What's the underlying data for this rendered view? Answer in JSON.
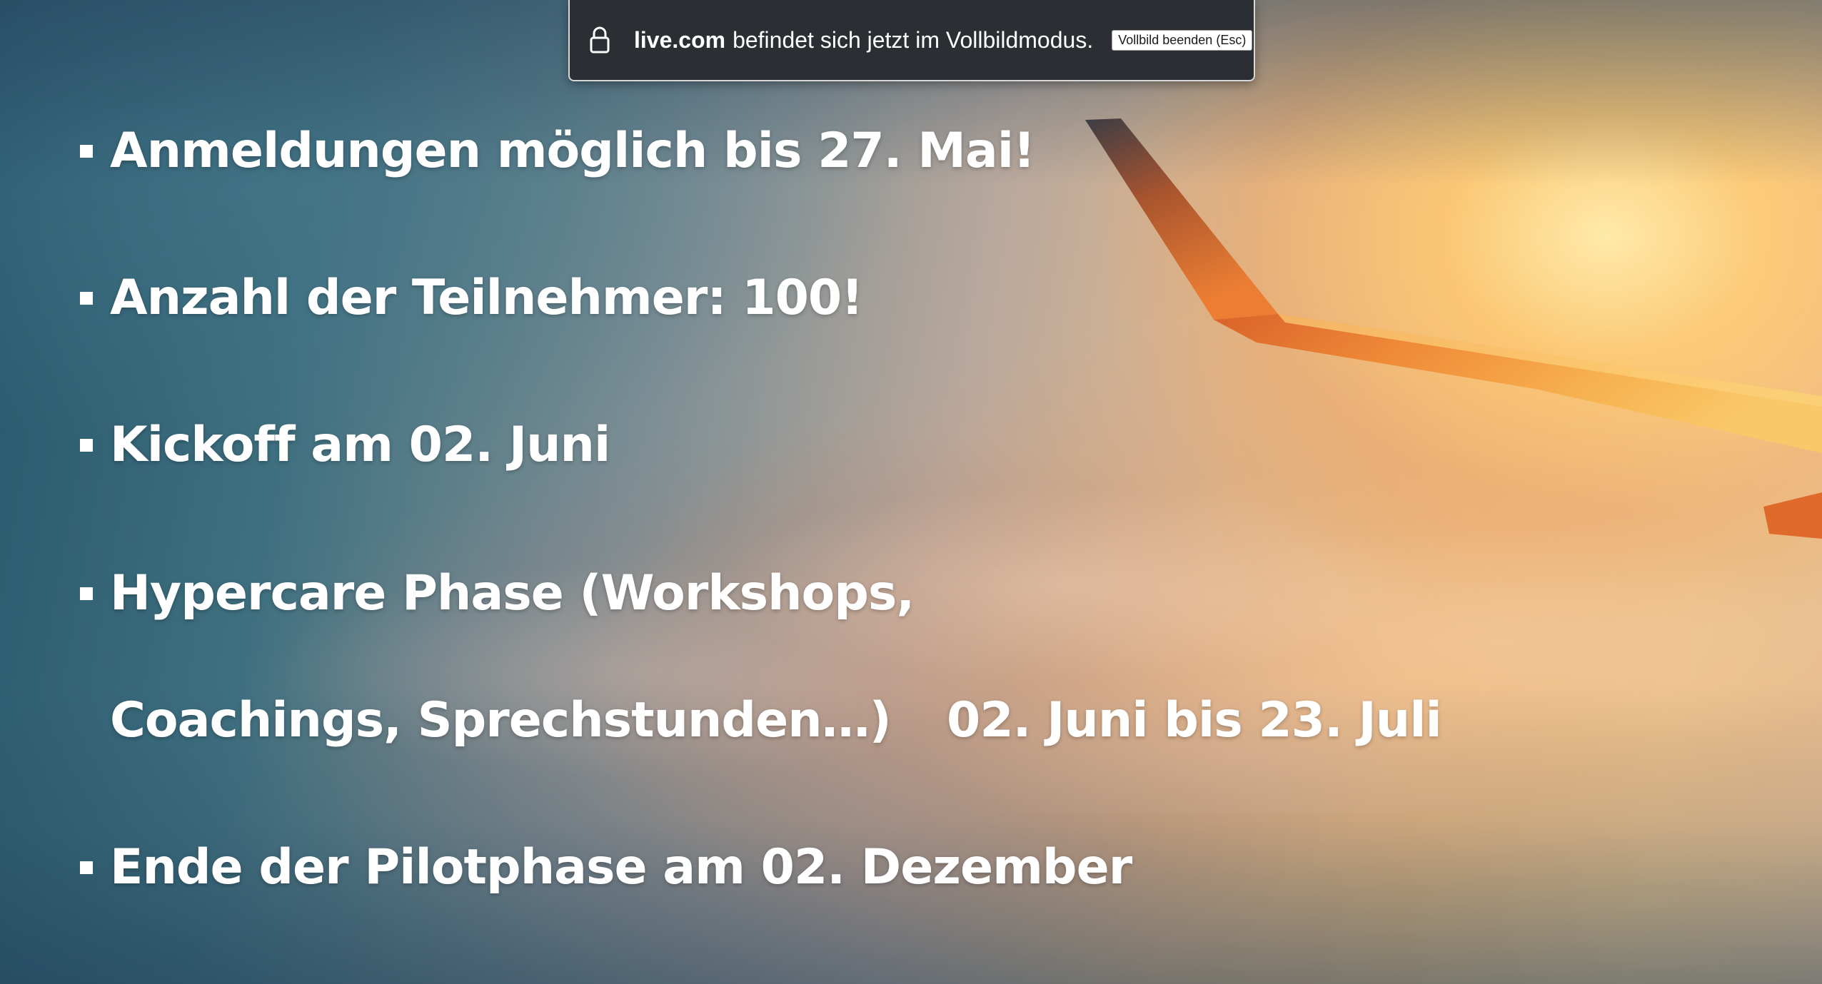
{
  "fullscreen_notice": {
    "icon": "lock-icon",
    "domain": "live.com",
    "message": "befindet sich jetzt im Vollbildmodus.",
    "exit_label": "Vollbild beenden (Esc)"
  },
  "slide": {
    "bullets": [
      {
        "text": "Anmeldungen möglich bis 27. Mai!"
      },
      {
        "text": "Anzahl der Teilnehmer: 100!"
      },
      {
        "text": "Kickoff am 02. Juni"
      },
      {
        "text": "Hypercare Phase (Workshops,",
        "continuation": "Coachings, Sprechstunden…)",
        "date": "02. Juni bis 23. Juli"
      },
      {
        "text": "Ende der Pilotphase am 02. Dezember"
      }
    ]
  },
  "colors": {
    "notice_background": "#2b2f34",
    "text": "#ffffff",
    "wing": "#e8832f"
  }
}
